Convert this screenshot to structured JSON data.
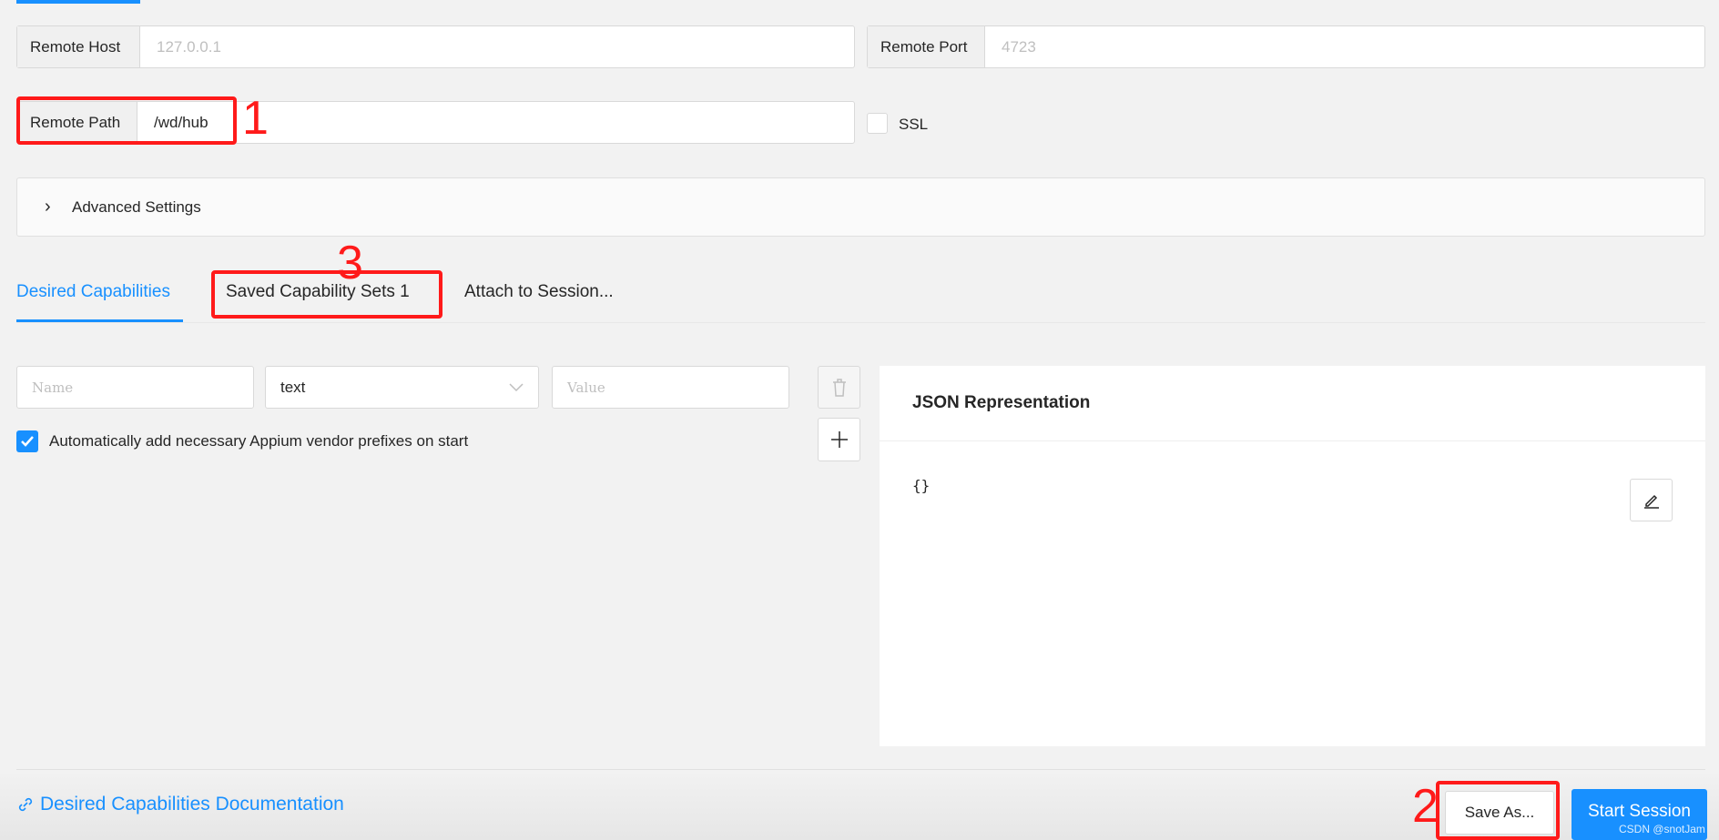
{
  "connection": {
    "remote_host": {
      "label": "Remote Host",
      "placeholder": "127.0.0.1"
    },
    "remote_port": {
      "label": "Remote Port",
      "placeholder": "4723"
    },
    "remote_path": {
      "label": "Remote Path",
      "value": "/wd/hub"
    },
    "ssl": {
      "label": "SSL",
      "checked": false
    }
  },
  "advanced_settings": {
    "label": "Advanced Settings",
    "expanded": false
  },
  "tabs": [
    {
      "label": "Desired Capabilities",
      "active": true
    },
    {
      "label": "Saved Capability Sets 1",
      "active": false
    },
    {
      "label": "Attach to Session...",
      "active": false
    }
  ],
  "capability_row": {
    "name_placeholder": "Name",
    "type_value": "text",
    "value_placeholder": "Value"
  },
  "auto_prefix": {
    "label": "Automatically add necessary Appium vendor prefixes on start",
    "checked": true
  },
  "json_panel": {
    "title": "JSON Representation",
    "content": "{}"
  },
  "footer": {
    "doc_link": "Desired Capabilities Documentation",
    "save_as": "Save As...",
    "start_session": "Start Session"
  },
  "annotations": [
    "1",
    "2",
    "3"
  ],
  "watermark": "CSDN @snotJam",
  "colors": {
    "accent": "#1890ff",
    "annotation": "#ff1a1a",
    "background": "#f2f2f2"
  }
}
